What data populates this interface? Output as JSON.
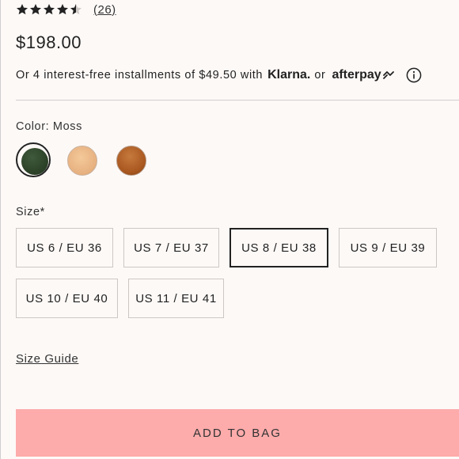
{
  "rating": {
    "stars": 4.5,
    "review_count": "(26)"
  },
  "price": "$198.00",
  "installments": {
    "text": "Or 4 interest-free installments of $49.50 with",
    "klarna": "Klarna.",
    "or": "or",
    "afterpay": "afterpay"
  },
  "color": {
    "label": "Color: Moss",
    "swatches": [
      {
        "name": "Moss",
        "color": "#2d4329",
        "selected": true
      },
      {
        "name": "Tan",
        "color": "#e7b07f",
        "selected": false
      },
      {
        "name": "Cognac",
        "color": "#a9571f",
        "selected": false
      }
    ]
  },
  "size": {
    "label": "Size*",
    "options": [
      {
        "label": "US 6 / EU 36",
        "selected": false
      },
      {
        "label": "US 7 / EU 37",
        "selected": false
      },
      {
        "label": "US 8 / EU 38",
        "selected": true
      },
      {
        "label": "US 9 / EU 39",
        "selected": false
      },
      {
        "label": "US 10 / EU 40",
        "selected": false
      },
      {
        "label": "US 11 / EU 41",
        "selected": false
      }
    ]
  },
  "size_guide": "Size Guide",
  "add_to_bag": "ADD TO BAG",
  "colors": {
    "background": "#fdf9f7",
    "button": "#fdabab",
    "text": "#222222"
  }
}
